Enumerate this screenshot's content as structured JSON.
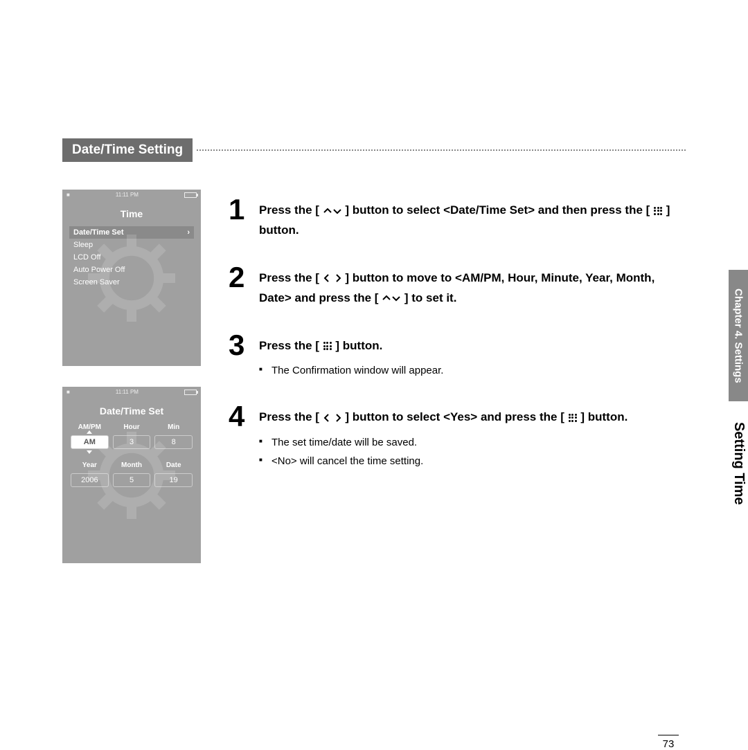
{
  "section_title": "Date/Time Setting",
  "status_time": "11:11 PM",
  "device1": {
    "title": "Time",
    "menu": [
      "Date/Time Set",
      "Sleep",
      "LCD Off",
      "Auto Power Off",
      "Screen Saver"
    ]
  },
  "device2": {
    "title": "Date/Time Set",
    "row1_labels": [
      "AM/PM",
      "Hour",
      "Min"
    ],
    "row1_values": [
      "AM",
      "3",
      "8"
    ],
    "row2_labels": [
      "Year",
      "Month",
      "Date"
    ],
    "row2_values": [
      "2006",
      "5",
      "19"
    ]
  },
  "steps": {
    "s1": {
      "num": "1",
      "a": "Press the [",
      "b": "] button to select <Date/Time Set> and then press the [",
      "c": "] button."
    },
    "s2": {
      "num": "2",
      "a": "Press the [",
      "b": "] button to move to <AM/PM, Hour, Minute, Year, Month, Date> and press the [",
      "c": "] to set it."
    },
    "s3": {
      "num": "3",
      "a": "Press the [",
      "b": "] button.",
      "sub1": "The Confirmation window will appear."
    },
    "s4": {
      "num": "4",
      "a": "Press the [",
      "b": "] button to select <Yes> and press the [",
      "c": "] button.",
      "sub1": "The set time/date will be saved.",
      "sub2": "<No> will cancel the time setting."
    }
  },
  "side_tab": "Chapter 4. Settings",
  "side_label": "Setting Time",
  "page_number": "73"
}
